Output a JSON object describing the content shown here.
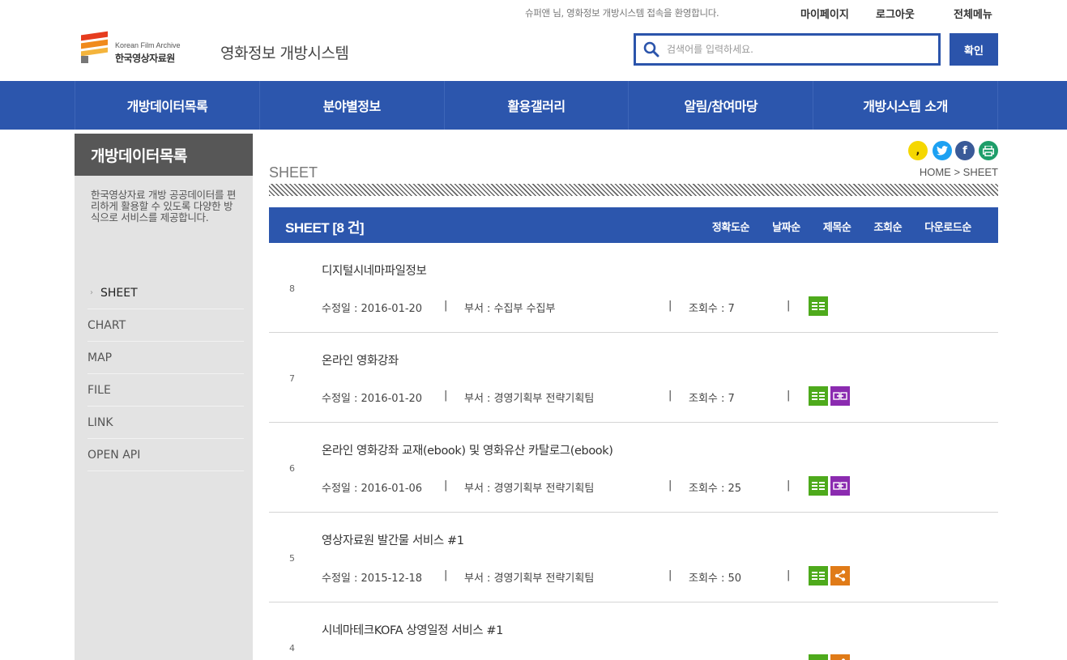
{
  "util": {
    "welcome": "슈퍼앤 님, 영화정보 개방시스템 접속을 환영합니다.",
    "mypage": "마이페이지",
    "logout": "로그아웃",
    "allmenu": "전체메뉴"
  },
  "header": {
    "logo_en": "Korean Film Archive",
    "logo_ko": "한국영상자료원",
    "site_title": "영화정보 개방시스템",
    "search_placeholder": "검색어를 입력하세요.",
    "search_button": "확인"
  },
  "gnb": [
    "개방데이터목록",
    "분야별정보",
    "활용갤러리",
    "알림/참여마당",
    "개방시스템 소개"
  ],
  "lnb": {
    "title": "개방데이터목록",
    "desc": "한국영상자료 개방 공공데이터를 편리하게 활용할 수 있도록 다양한 방식으로 서비스를 제공합니다.",
    "items": [
      "SHEET",
      "CHART",
      "MAP",
      "FILE",
      "LINK",
      "OPEN API"
    ],
    "active_index": 0
  },
  "content": {
    "heading": "SHEET",
    "breadcrumb": "HOME > SHEET",
    "list_title": "SHEET [8 건]",
    "sorts": [
      "정확도순",
      "날짜순",
      "제목순",
      "조회순",
      "다운로드순"
    ],
    "rows": [
      {
        "num": "8",
        "title": "디지털시네마파일정보",
        "date": "수정일 : 2016-01-20",
        "dept": "부서 : 수집부   수집부",
        "views": "조회수 : 7",
        "formats": [
          "sheet"
        ]
      },
      {
        "num": "7",
        "title": "온라인 영화강좌",
        "date": "수정일 : 2016-01-20",
        "dept": "부서 : 경영기획부   전략기획팀",
        "views": "조회수 : 7",
        "formats": [
          "sheet",
          "link"
        ]
      },
      {
        "num": "6",
        "title": "온라인 영화강좌 교재(ebook) 및 영화유산 카탈로그(ebook)",
        "date": "수정일 : 2016-01-06",
        "dept": "부서 : 경영기획부   전략기획팀",
        "views": "조회수 : 25",
        "formats": [
          "sheet",
          "link"
        ]
      },
      {
        "num": "5",
        "title": "영상자료원 발간물 서비스 #1",
        "date": "수정일 : 2015-12-18",
        "dept": "부서 : 경영기획부   전략기획팀",
        "views": "조회수 : 50",
        "formats": [
          "sheet",
          "share"
        ]
      },
      {
        "num": "4",
        "title": "시네마테크KOFA 상영일정 서비스 #1",
        "date": "",
        "dept": "",
        "views": "",
        "formats": [
          "sheet",
          "share"
        ]
      }
    ]
  },
  "colors": {
    "primary": "#2c56ad",
    "sidebar_title": "#575757",
    "sheet_icon": "#4eaa1c",
    "link_icon": "#8b2bb0",
    "share_icon": "#e07b18"
  }
}
